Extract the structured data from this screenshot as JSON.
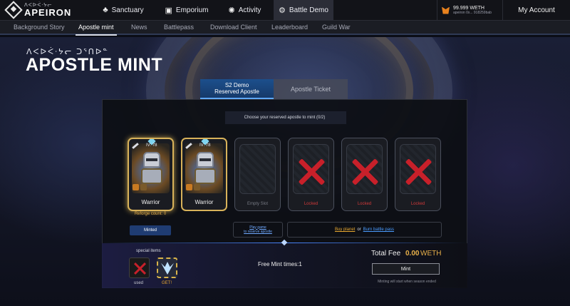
{
  "logo": {
    "runes": "ᐱᐸᐅᐹᐧᔭᓕ",
    "name": "APEIRON"
  },
  "nav": {
    "main": [
      {
        "label": "Sanctuary",
        "icon": "sanctuary-icon",
        "glyph": "♣"
      },
      {
        "label": "Emporium",
        "icon": "shop-icon",
        "glyph": "▣"
      },
      {
        "label": "Activity",
        "icon": "activity-icon",
        "glyph": "✺"
      },
      {
        "label": "Battle Demo",
        "icon": "battle-icon",
        "glyph": "⚙"
      }
    ],
    "sub": [
      {
        "label": "Background Story"
      },
      {
        "label": "Apostle  mint"
      },
      {
        "label": "News"
      },
      {
        "label": "Battlepass"
      },
      {
        "label": "Download Client"
      },
      {
        "label": "Leaderboard"
      },
      {
        "label": "Guild War"
      }
    ]
  },
  "wallet": {
    "balance": "99.999 WETH",
    "address": "apeiron 0x... 918259bab"
  },
  "account": {
    "label": "My Account"
  },
  "heading": {
    "runes": "ᐱᐸᐅᐹᐧᔭᓕ ᑐᕐᑎᐅᓐ",
    "title": "APOSTLE MINT"
  },
  "mint_tabs": {
    "active_line1": "S2 Demo",
    "active_line2": "Reserved Apostle",
    "inactive": "Apostle Ticket"
  },
  "panel": {
    "choose_text": "Choose your reserved apostle to mint (0/2)",
    "cards": [
      {
        "type": "apostle",
        "iv": "IV: 78",
        "class": "Warrior"
      },
      {
        "type": "apostle",
        "iv": "IV: 78",
        "class": "Warrior"
      },
      {
        "type": "empty",
        "label": "Empty Slot"
      },
      {
        "type": "locked",
        "label": "Locked"
      },
      {
        "type": "locked",
        "label": "Locked"
      },
      {
        "type": "locked",
        "label": "Locked"
      }
    ],
    "reforge": "Reforge count: 0",
    "minted": "Minted",
    "play_line1": "Play game",
    "play_line2": "to reserve apostle",
    "buy_planet": "Buy planet",
    "or": "or",
    "burn_pass": "Burn battle pass"
  },
  "footer": {
    "special_items": "special items",
    "used": "used",
    "get": "GET!",
    "free_mint": "Free Mint times:1",
    "total_fee_label": "Total Fee",
    "total_fee_amount": "0.00",
    "total_fee_unit": "WETH",
    "mint_button": "Mint",
    "note": "Minting will start when season ended"
  },
  "colors": {
    "accent_gold": "#e8b04a",
    "accent_blue": "#1c4f8c",
    "locked_red": "#c8202a"
  }
}
